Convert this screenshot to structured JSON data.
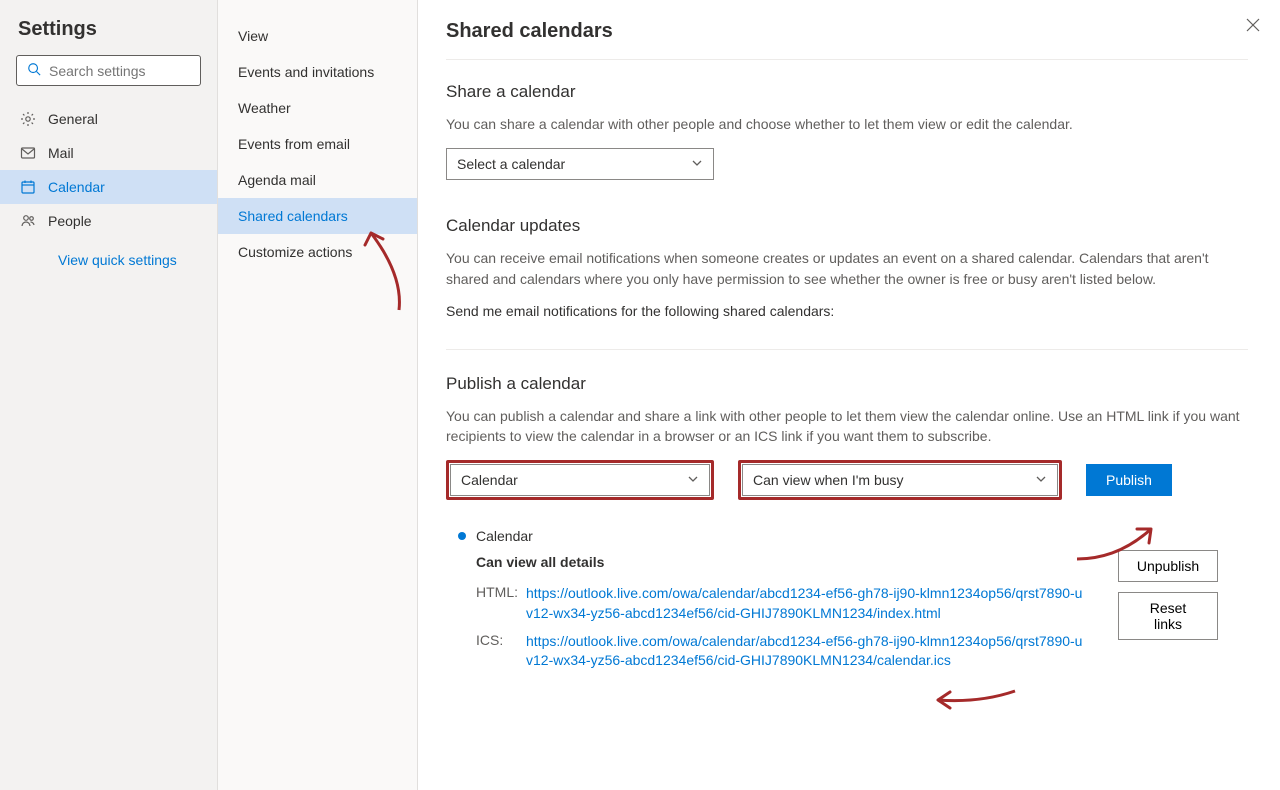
{
  "settings_title": "Settings",
  "search_placeholder": "Search settings",
  "nav": [
    {
      "icon": "gear",
      "label": "General"
    },
    {
      "icon": "mail",
      "label": "Mail"
    },
    {
      "icon": "calendar",
      "label": "Calendar"
    },
    {
      "icon": "people",
      "label": "People"
    }
  ],
  "view_quick": "View quick settings",
  "sub_nav": [
    "View",
    "Events and invitations",
    "Weather",
    "Events from email",
    "Agenda mail",
    "Shared calendars",
    "Customize actions"
  ],
  "page_title": "Shared calendars",
  "share": {
    "title": "Share a calendar",
    "desc": "You can share a calendar with other people and choose whether to let them view or edit the calendar.",
    "select_label": "Select a calendar"
  },
  "updates": {
    "title": "Calendar updates",
    "desc": "You can receive email notifications when someone creates or updates an event on a shared calendar. Calendars that aren't shared and calendars where you only have permission to see whether the owner is free or busy aren't listed below.",
    "note": "Send me email notifications for the following shared calendars:"
  },
  "publish": {
    "title": "Publish a calendar",
    "desc": "You can publish a calendar and share a link with other people to let them view the calendar online. Use an HTML link if you want recipients to view the calendar in a browser or an ICS link if you want them to subscribe.",
    "select_cal": "Calendar",
    "select_perm": "Can view when I'm busy",
    "publish_btn": "Publish",
    "published_name": "Calendar",
    "perm_label": "Can view all details",
    "html_label": "HTML:",
    "ics_label": "ICS:",
    "html_url": "https://outlook.live.com/owa/calendar/abcd1234-ef56-gh78-ij90-klmn1234op56/qrst7890-uv12-wx34-yz56-abcd1234ef56/cid-GHIJ7890KLMN1234/index.html",
    "ics_url": "https://outlook.live.com/owa/calendar/abcd1234-ef56-gh78-ij90-klmn1234op56/qrst7890-uv12-wx34-yz56-abcd1234ef56/cid-GHIJ7890KLMN1234/calendar.ics",
    "unpublish_btn": "Unpublish",
    "reset_btn": "Reset links"
  }
}
